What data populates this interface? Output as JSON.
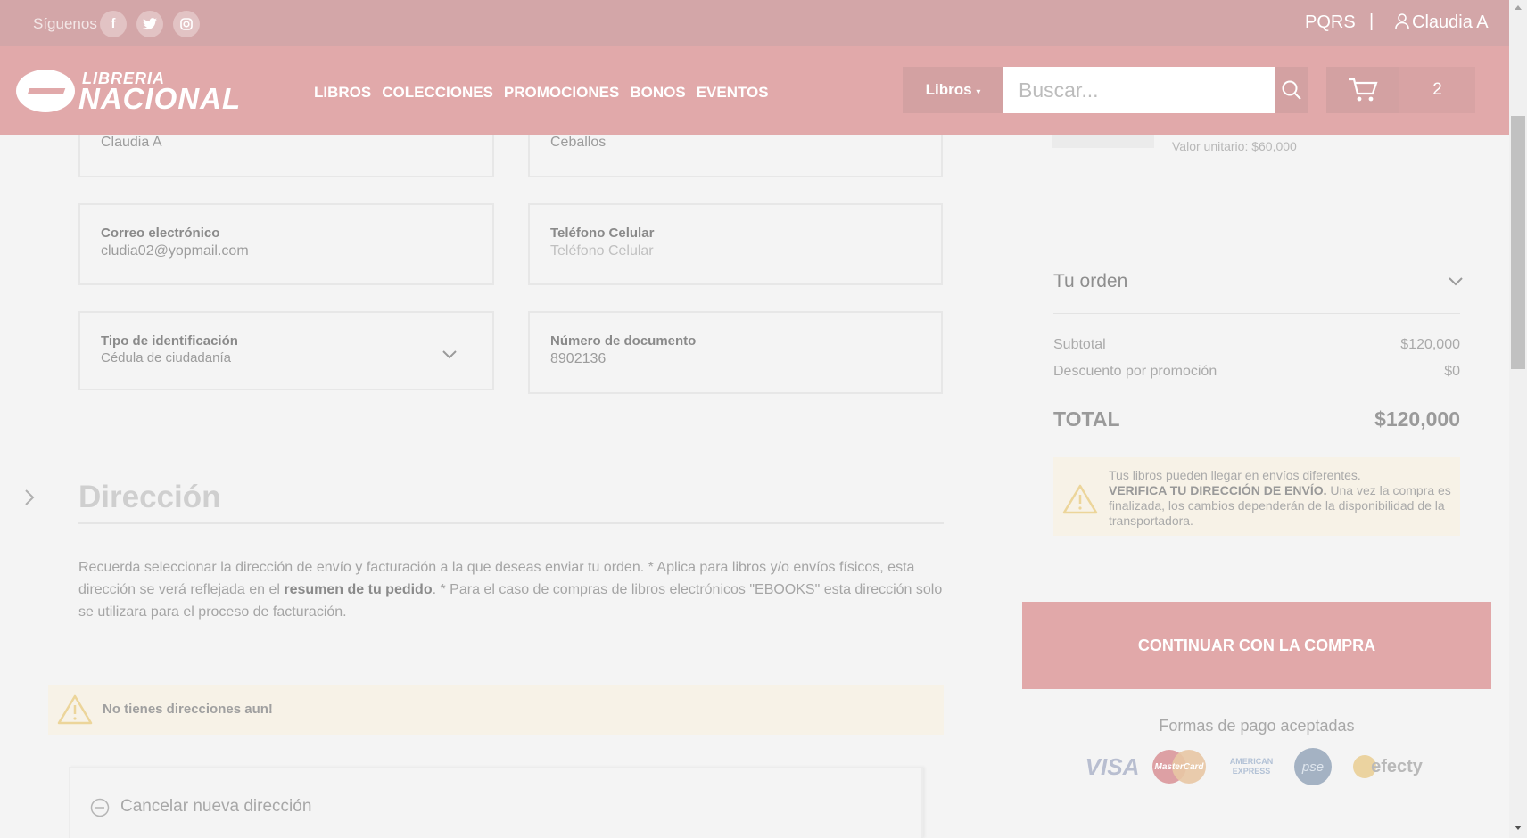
{
  "topbar": {
    "follow_label": "Síguenos",
    "social": [
      "facebook-icon",
      "twitter-icon",
      "instagram-icon"
    ],
    "pqrs": "PQRS",
    "separator": "|",
    "user_name": "Claudia A"
  },
  "nav": {
    "logo_line1": "LIBRERIA",
    "logo_line2": "NACIONAL",
    "menu": [
      "LIBROS",
      "COLECCIONES",
      "PROMOCIONES",
      "BONOS",
      "EVENTOS"
    ],
    "category": "Libros",
    "search_placeholder": "Buscar...",
    "cart_count": "2"
  },
  "form": {
    "first_name_value": "Claudia A",
    "last_name_value": "Ceballos",
    "email_label": "Correo electrónico",
    "email_value": "cludia02@yopmail.com",
    "phone_label": "Teléfono Celular",
    "phone_placeholder": "Teléfono Celular",
    "id_type_label": "Tipo de identificación",
    "id_type_value": "Cédula de ciudadanía",
    "doc_label": "Número de documento",
    "doc_value": "8902136"
  },
  "address": {
    "title": "Dirección",
    "desc_part1": "Recuerda seleccionar la dirección de envío y facturación a la que deseas enviar tu orden. * Aplica para libros y/o envíos físicos, esta dirección se verá reflejada en el ",
    "desc_bold": "resumen de tu pedido",
    "desc_part2": ". * Para el caso de compras de libros electrónicos \"EBOOKS\" esta dirección solo se utilizara para el proceso de facturación.",
    "no_address": "No tienes direcciones aun!",
    "cancel_new": "Cancelar nueva dirección"
  },
  "summary": {
    "unit_price": "Valor unitario: $60,000",
    "order_title": "Tu orden",
    "subtotal_label": "Subtotal",
    "subtotal_value": "$120,000",
    "discount_label": "Descuento por promoción",
    "discount_value": "$0",
    "total_label": "TOTAL",
    "total_value": "$120,000",
    "notice_line1": "Tus libros pueden llegar en envíos diferentes.",
    "notice_bold": "VERIFICA TU DIRECCIÓN DE ENVÍO.",
    "notice_line2": " Una vez la compra es finalizada, los cambios dependerán de la disponibilidad de la transportadora.",
    "continue": "CONTINUAR CON LA COMPRA",
    "payment_title": "Formas de pago aceptadas",
    "payment_visa": "VISA",
    "payment_mc": "MasterCard",
    "payment_amex_1": "AMERICAN",
    "payment_amex_2": "EXPRESS",
    "payment_pse": "pse",
    "payment_efecty": "efecty"
  },
  "colors": {
    "topbar": "#d3a6a8",
    "nav": "#e1a9aa",
    "button": "#e1a8a9",
    "alert_bg": "#f7f2e7"
  }
}
